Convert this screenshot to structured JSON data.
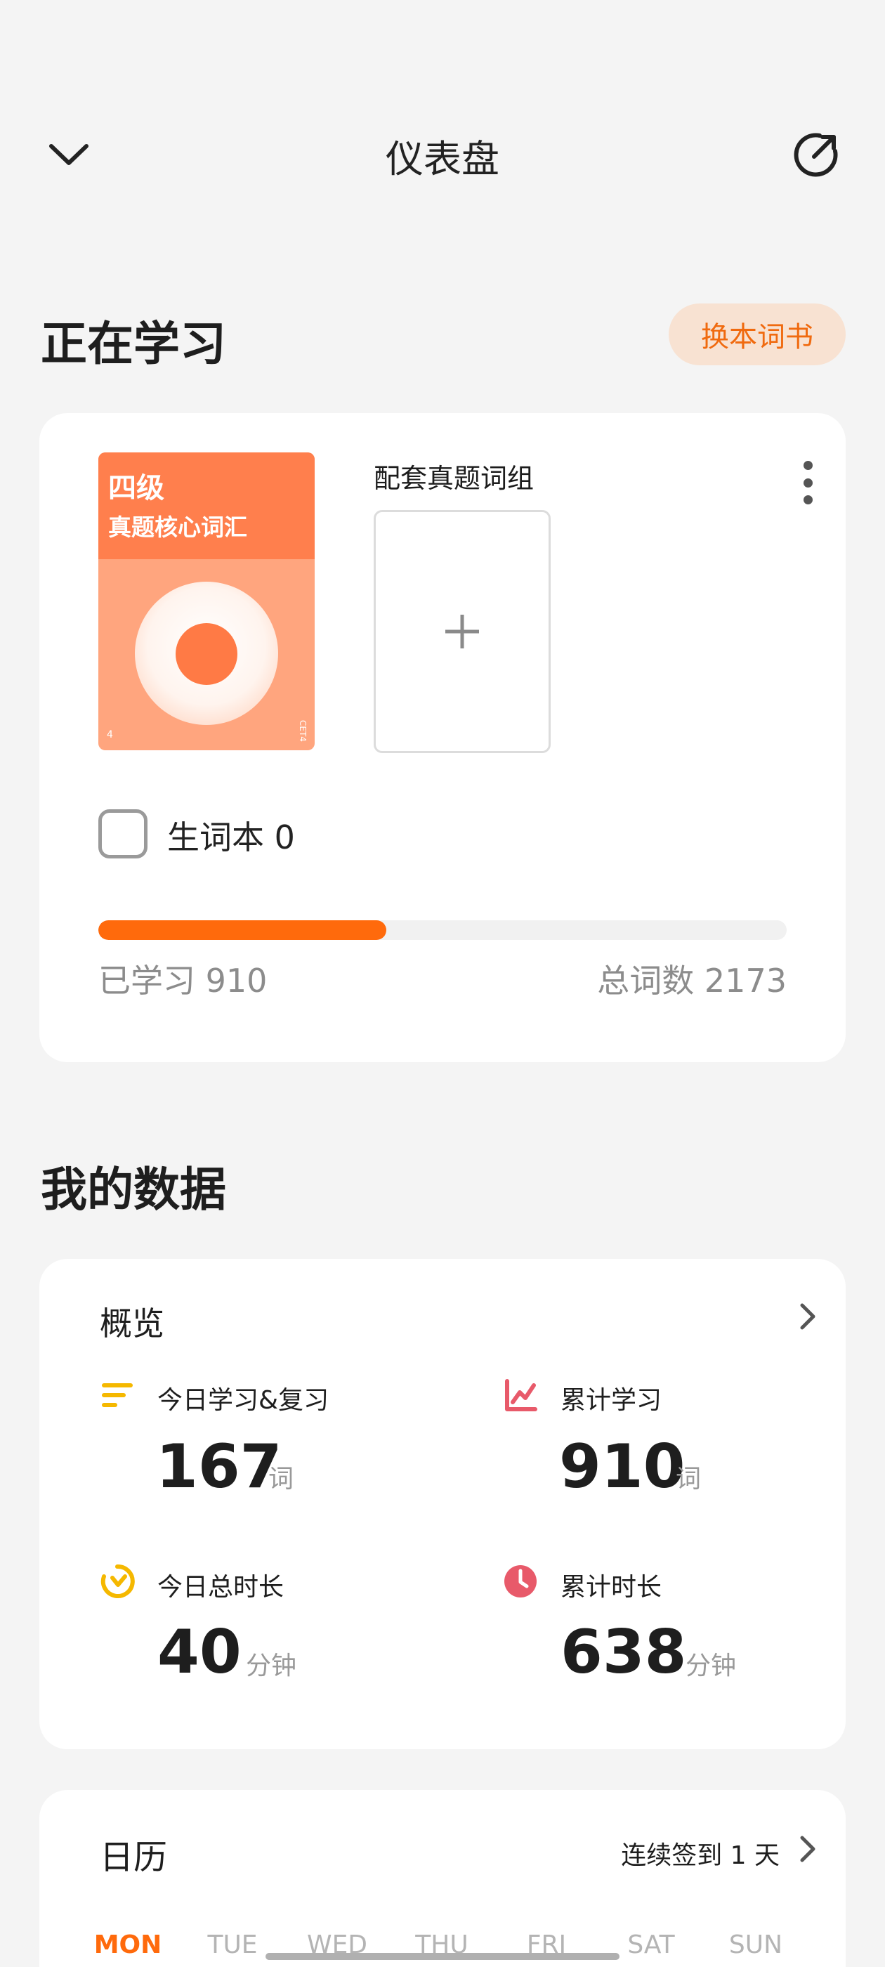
{
  "header": {
    "title": "仪表盘",
    "back_icon": "chevron-down-icon",
    "share_icon": "share-arrow-icon"
  },
  "studying": {
    "section_title": "正在学习",
    "switch_button": "换本词书",
    "book": {
      "level": "四级",
      "name": "真题核心词汇",
      "corner_left": "4",
      "corner_right": "CET4"
    },
    "group_label": "配套真题词组",
    "add_icon": "plus-icon",
    "more_icon": "more-vertical-icon",
    "vocab_label": "生词本 0",
    "learned_label": "已学习 910",
    "total_label": "总词数 2173",
    "learned": 910,
    "total": 2173,
    "accent_color": "#ff6a0c"
  },
  "my_data": {
    "section_title": "我的数据",
    "overview": {
      "title": "概览",
      "stats": [
        {
          "label": "今日学习&复习",
          "value": "167",
          "unit": "词",
          "icon": "lines-icon",
          "color": "#f5b800"
        },
        {
          "label": "累计学习",
          "value": "910",
          "unit": "词",
          "icon": "line-chart-icon",
          "color": "#e85a6a"
        },
        {
          "label": "今日总时长",
          "value": "40",
          "unit": "分钟",
          "icon": "timer-icon",
          "color": "#f5b800"
        },
        {
          "label": "累计时长",
          "value": "638",
          "unit": "分钟",
          "icon": "clock-icon",
          "color": "#e85a6a"
        }
      ]
    },
    "calendar": {
      "title": "日历",
      "streak": "连续签到 1 天",
      "weekdays": [
        "MON",
        "TUE",
        "WED",
        "THU",
        "FRI",
        "SAT",
        "SUN"
      ],
      "active_day": "MON"
    }
  }
}
